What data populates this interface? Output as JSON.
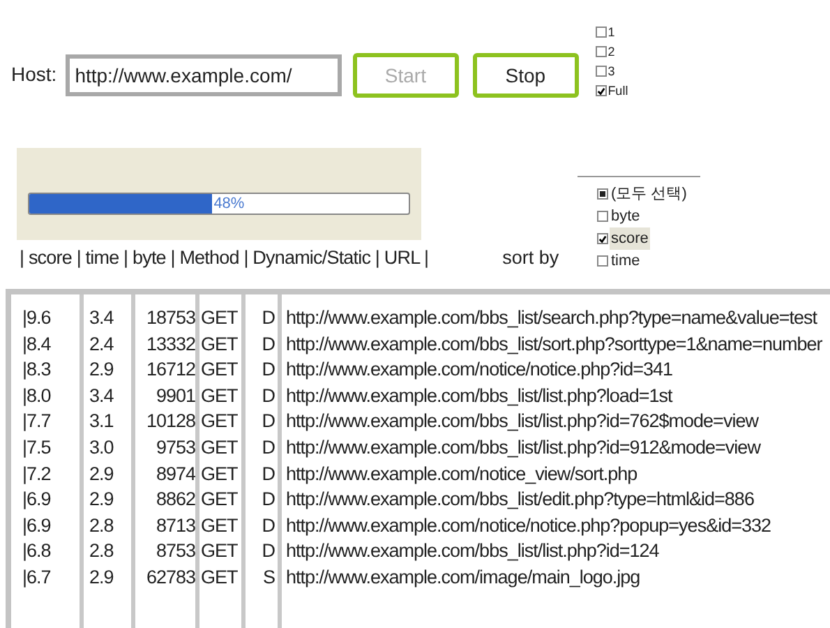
{
  "host": {
    "label": "Host:",
    "value": "http://www.example.com/"
  },
  "buttons": [
    {
      "label": "Start",
      "disabled": true
    },
    {
      "label": "Stop",
      "disabled": false
    }
  ],
  "depth_options": [
    {
      "label": "1",
      "checked": false
    },
    {
      "label": "2",
      "checked": false
    },
    {
      "label": "3",
      "checked": false
    },
    {
      "label": "Full",
      "checked": true
    }
  ],
  "progress": {
    "level": 0.48,
    "reading": "48%"
  },
  "columns_header": "| score | time | byte | Method | Dynamic/Static | URL |",
  "sort": {
    "label": "sort by",
    "items": [
      {
        "label": "(모두 선택)",
        "checked": false,
        "partial": true,
        "selected": false
      },
      {
        "label": "byte",
        "checked": false,
        "partial": false,
        "selected": false
      },
      {
        "label": "score",
        "checked": true,
        "partial": false,
        "selected": true
      },
      {
        "label": "time",
        "checked": false,
        "partial": false,
        "selected": false
      }
    ]
  },
  "rows": [
    {
      "score": "|9.6",
      "time": "3.4",
      "byte": "18753",
      "method": "GET",
      "type": "D",
      "url": "http://www.example.com/bbs_list/search.php?type=name&value=test"
    },
    {
      "score": "|8.4",
      "time": "2.4",
      "byte": "13332",
      "method": "GET",
      "type": "D",
      "url": "http://www.example.com/bbs_list/sort.php?sorttype=1&name=number"
    },
    {
      "score": "|8.3",
      "time": "2.9",
      "byte": "16712",
      "method": "GET",
      "type": "D",
      "url": "http://www.example.com/notice/notice.php?id=341"
    },
    {
      "score": "|8.0",
      "time": "3.4",
      "byte": "9901",
      "method": "GET",
      "type": "D",
      "url": "http://www.example.com/bbs_list/list.php?load=1st"
    },
    {
      "score": "|7.7",
      "time": "3.1",
      "byte": "10128",
      "method": "GET",
      "type": "D",
      "url": "http://www.example.com/bbs_list/list.php?id=762$mode=view"
    },
    {
      "score": "|7.5",
      "time": "3.0",
      "byte": "9753",
      "method": "GET",
      "type": "D",
      "url": "http://www.example.com/bbs_list/list.php?id=912&mode=view"
    },
    {
      "score": "|7.2",
      "time": "2.9",
      "byte": "8974",
      "method": "GET",
      "type": "D",
      "url": "http://www.example.com/notice_view/sort.php"
    },
    {
      "score": "|6.9",
      "time": "2.9",
      "byte": "8862",
      "method": "GET",
      "type": "D",
      "url": "http://www.example.com/bbs_list/edit.php?type=html&id=886"
    },
    {
      "score": "|6.9",
      "time": "2.8",
      "byte": "8713",
      "method": "GET",
      "type": "D",
      "url": "http://www.example.com/notice/notice.php?popup=yes&id=332"
    },
    {
      "score": "|6.8",
      "time": "2.8",
      "byte": "8753",
      "method": "GET",
      "type": "D",
      "url": "http://www.example.com/bbs_list/list.php?id=124"
    },
    {
      "score": "|6.7",
      "time": "2.9",
      "byte": "62783",
      "method": "GET",
      "type": "S",
      "url": "http://www.example.com/image/main_logo.jpg"
    }
  ]
}
